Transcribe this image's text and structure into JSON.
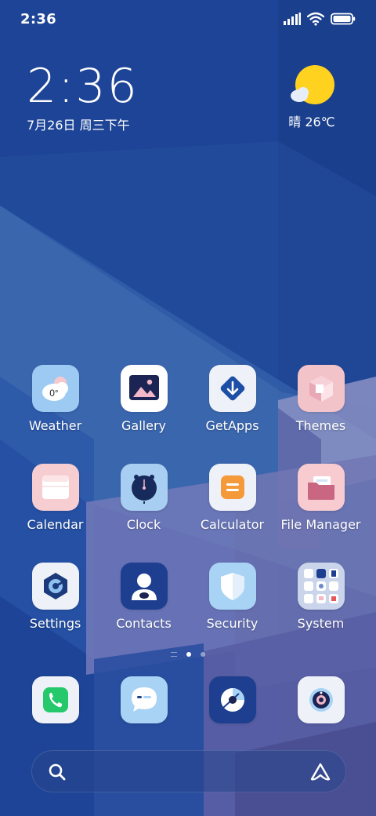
{
  "status_bar": {
    "time": "2:36",
    "icons": [
      "signal-icon",
      "wifi-icon",
      "battery-icon"
    ]
  },
  "clock_widget": {
    "time": "2:36",
    "date": "7月26日 周三下午"
  },
  "weather_widget": {
    "icon": "sunny-cloud-icon",
    "text": "晴 26℃"
  },
  "apps": [
    {
      "label": "Weather",
      "icon": "weather-icon"
    },
    {
      "label": "Gallery",
      "icon": "gallery-icon"
    },
    {
      "label": "GetApps",
      "icon": "getapps-icon"
    },
    {
      "label": "Themes",
      "icon": "themes-icon"
    },
    {
      "label": "Calendar",
      "icon": "calendar-icon"
    },
    {
      "label": "Clock",
      "icon": "clock-icon"
    },
    {
      "label": "Calculator",
      "icon": "calculator-icon"
    },
    {
      "label": "File Manager",
      "icon": "file-manager-icon"
    },
    {
      "label": "Settings",
      "icon": "settings-icon"
    },
    {
      "label": "Contacts",
      "icon": "contacts-icon"
    },
    {
      "label": "Security",
      "icon": "security-icon"
    },
    {
      "label": "System",
      "icon": "folder-icon"
    }
  ],
  "weather_app_icon_text": "0°",
  "page_indicator": {
    "pages": 2,
    "active": 1
  },
  "dock": [
    {
      "icon": "phone-icon"
    },
    {
      "icon": "messages-icon"
    },
    {
      "icon": "browser-icon"
    },
    {
      "icon": "camera-icon"
    }
  ],
  "search_bar": {
    "left_icon": "search-icon",
    "right_icon": "assistant-icon"
  },
  "colors": {
    "wallpaper_base": "#1d4496",
    "accent_blue": "#1e3f8f",
    "sun_yellow": "#ffd21f",
    "phone_green": "#25c96b"
  }
}
